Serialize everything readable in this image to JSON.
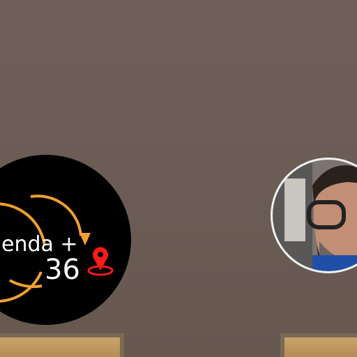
{
  "logo": {
    "text_line1": "enda +",
    "text_line2": "36",
    "arrow_color": "#f0a030",
    "pin_color": "#ff1a1a"
  },
  "profile": {
    "name": "profile-photo"
  }
}
